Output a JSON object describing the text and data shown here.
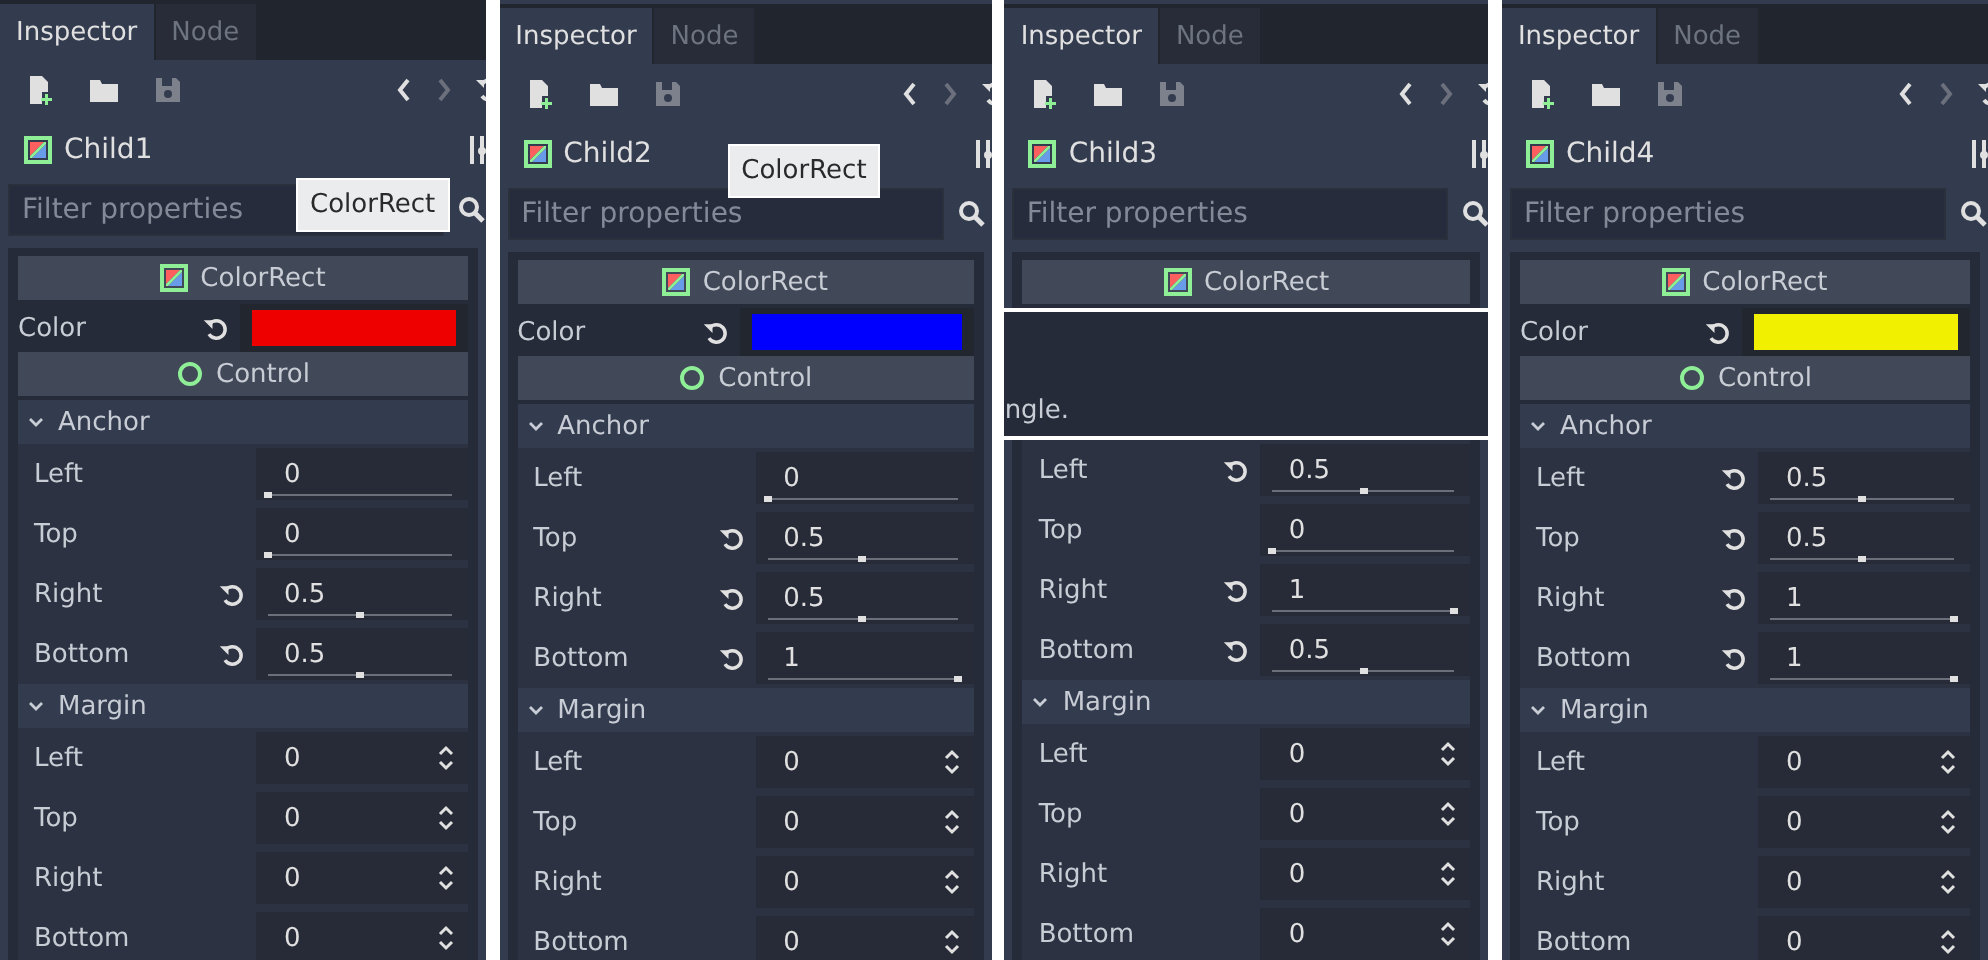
{
  "panels": [
    {
      "tabs": [
        {
          "label": "Inspector",
          "selected": true
        },
        {
          "label": "Node",
          "selected": false
        }
      ],
      "node_name": "Child1",
      "filter_placeholder": "Filter properties",
      "tooltip": "ColorRect",
      "items": [
        {
          "kind": "class_header",
          "text": "ColorRect"
        },
        {
          "kind": "color",
          "label": "Color",
          "color": "#ee0000",
          "revertible": true
        },
        {
          "kind": "category",
          "text": "Control"
        },
        {
          "kind": "group",
          "text": "Anchor",
          "expanded": true
        },
        {
          "kind": "range",
          "label": "Left",
          "value": "0",
          "level": 0,
          "revertible": false
        },
        {
          "kind": "range",
          "label": "Top",
          "value": "0",
          "level": 0,
          "revertible": false
        },
        {
          "kind": "range",
          "label": "Right",
          "value": "0.5",
          "level": 0.5,
          "revertible": true
        },
        {
          "kind": "range",
          "label": "Bottom",
          "value": "0.5",
          "level": 0.5,
          "revertible": true
        },
        {
          "kind": "group",
          "text": "Margin",
          "expanded": true
        },
        {
          "kind": "spin",
          "label": "Left",
          "value": "0"
        },
        {
          "kind": "spin",
          "label": "Top",
          "value": "0"
        },
        {
          "kind": "spin",
          "label": "Right",
          "value": "0"
        },
        {
          "kind": "spin",
          "label": "Bottom",
          "value": "0"
        }
      ]
    },
    {
      "tabs": [
        {
          "label": "Inspector",
          "selected": true
        },
        {
          "label": "Node",
          "selected": false
        }
      ],
      "node_name": "Child2",
      "filter_placeholder": "Filter properties",
      "tooltip": "ColorRect",
      "items": [
        {
          "kind": "class_header",
          "text": "ColorRect"
        },
        {
          "kind": "color",
          "label": "Color",
          "color": "#0000ff",
          "revertible": true
        },
        {
          "kind": "category",
          "text": "Control"
        },
        {
          "kind": "group",
          "text": "Anchor",
          "expanded": true
        },
        {
          "kind": "range",
          "label": "Left",
          "value": "0",
          "level": 0,
          "revertible": false
        },
        {
          "kind": "range",
          "label": "Top",
          "value": "0.5",
          "level": 0.5,
          "revertible": true
        },
        {
          "kind": "range",
          "label": "Right",
          "value": "0.5",
          "level": 0.5,
          "revertible": true
        },
        {
          "kind": "range",
          "label": "Bottom",
          "value": "1",
          "level": 1,
          "revertible": true
        },
        {
          "kind": "group",
          "text": "Margin",
          "expanded": true
        },
        {
          "kind": "spin",
          "label": "Left",
          "value": "0"
        },
        {
          "kind": "spin",
          "label": "Top",
          "value": "0"
        },
        {
          "kind": "spin",
          "label": "Right",
          "value": "0"
        },
        {
          "kind": "spin",
          "label": "Bottom",
          "value": "0"
        }
      ]
    },
    {
      "tabs": [
        {
          "label": "Inspector",
          "selected": true
        },
        {
          "label": "Node",
          "selected": false
        }
      ],
      "node_name": "Child3",
      "filter_placeholder": "Filter properties",
      "items": [
        {
          "kind": "class_header",
          "text": "ColorRect"
        },
        {
          "kind": "tooltip_strip",
          "text": "ngle."
        },
        {
          "kind": "range",
          "label": "Left",
          "value": "0.5",
          "level": 0.5,
          "revertible": true
        },
        {
          "kind": "range",
          "label": "Top",
          "value": "0",
          "level": 0,
          "revertible": false
        },
        {
          "kind": "range",
          "label": "Right",
          "value": "1",
          "level": 1,
          "revertible": true
        },
        {
          "kind": "range",
          "label": "Bottom",
          "value": "0.5",
          "level": 0.5,
          "revertible": true
        },
        {
          "kind": "group",
          "text": "Margin",
          "expanded": true
        },
        {
          "kind": "spin",
          "label": "Left",
          "value": "0"
        },
        {
          "kind": "spin",
          "label": "Top",
          "value": "0"
        },
        {
          "kind": "spin",
          "label": "Right",
          "value": "0"
        },
        {
          "kind": "spin",
          "label": "Bottom",
          "value": "0"
        }
      ]
    },
    {
      "tabs": [
        {
          "label": "Inspector",
          "selected": true
        },
        {
          "label": "Node",
          "selected": false
        }
      ],
      "node_name": "Child4",
      "filter_placeholder": "Filter properties",
      "items": [
        {
          "kind": "class_header",
          "text": "ColorRect"
        },
        {
          "kind": "color",
          "label": "Color",
          "color": "#f0f000",
          "revertible": true
        },
        {
          "kind": "category",
          "text": "Control"
        },
        {
          "kind": "group",
          "text": "Anchor",
          "expanded": true
        },
        {
          "kind": "range",
          "label": "Left",
          "value": "0.5",
          "level": 0.5,
          "revertible": true
        },
        {
          "kind": "range",
          "label": "Top",
          "value": "0.5",
          "level": 0.5,
          "revertible": true
        },
        {
          "kind": "range",
          "label": "Right",
          "value": "1",
          "level": 1,
          "revertible": true
        },
        {
          "kind": "range",
          "label": "Bottom",
          "value": "1",
          "level": 1,
          "revertible": true
        },
        {
          "kind": "group",
          "text": "Margin",
          "expanded": true
        },
        {
          "kind": "spin",
          "label": "Left",
          "value": "0"
        },
        {
          "kind": "spin",
          "label": "Top",
          "value": "0"
        },
        {
          "kind": "spin",
          "label": "Right",
          "value": "0"
        },
        {
          "kind": "spin",
          "label": "Bottom",
          "value": "0"
        }
      ]
    }
  ]
}
